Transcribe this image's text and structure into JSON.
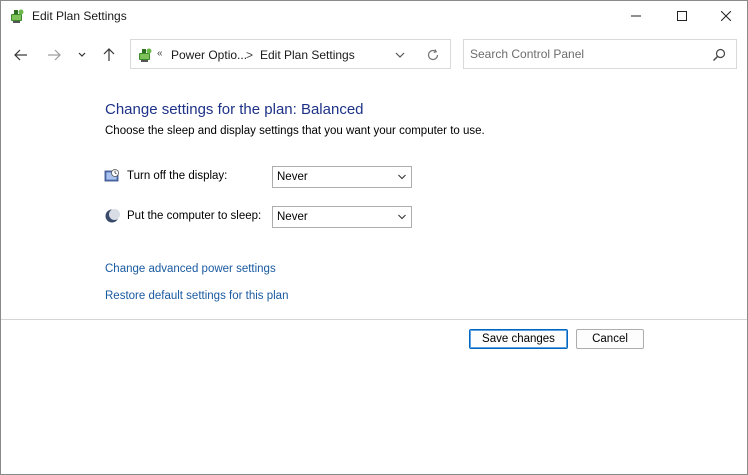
{
  "window": {
    "title": "Edit Plan Settings"
  },
  "nav": {
    "back_icon": "arrow-left-icon",
    "forward_icon": "arrow-right-icon",
    "recent_icon": "chevron-down-icon",
    "up_icon": "arrow-up-icon"
  },
  "address": {
    "chevron": "«",
    "crumbs": [
      "Power Optio...",
      "Edit Plan Settings"
    ],
    "separator": ">"
  },
  "search": {
    "placeholder": "Search Control Panel",
    "value": ""
  },
  "main": {
    "heading": "Change settings for the plan: Balanced",
    "description": "Choose the sleep and display settings that you want your computer to use.",
    "settings": [
      {
        "label": "Turn off the display:",
        "value": "Never",
        "icon": "monitor-icon"
      },
      {
        "label": "Put the computer to sleep:",
        "value": "Never",
        "icon": "moon-icon"
      }
    ],
    "links": [
      "Change advanced power settings",
      "Restore default settings for this plan"
    ]
  },
  "footer": {
    "save_label": "Save changes",
    "cancel_label": "Cancel"
  },
  "colors": {
    "heading": "#1e3287",
    "link": "#1a5aa0",
    "primary_border": "#0067c0"
  }
}
